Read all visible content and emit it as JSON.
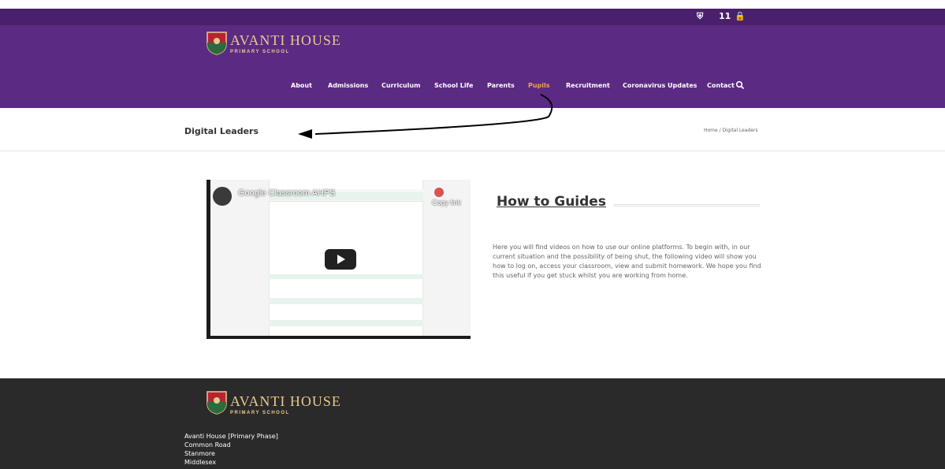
{
  "topbar": {
    "icon_shield": "shield-icon",
    "weather": "11",
    "icon_lock": "lock-icon"
  },
  "brand": {
    "title": "AVANTI HOUSE",
    "subtitle": "PRIMARY SCHOOL",
    "crest_colors": [
      "#b8232f",
      "#2d6a3e",
      "#e8c98f"
    ]
  },
  "nav": [
    {
      "label": "About"
    },
    {
      "label": "Admissions"
    },
    {
      "label": "Curriculum"
    },
    {
      "label": "School Life"
    },
    {
      "label": "Parents"
    },
    {
      "label": "Pupils",
      "active": true
    },
    {
      "label": "Recruitment"
    },
    {
      "label": "Coronavirus Updates"
    },
    {
      "label": "Contact"
    }
  ],
  "page": {
    "title": "Digital Leaders",
    "breadcrumb": "Home / Digital Leaders"
  },
  "video": {
    "title": "Google Classroom AHPS",
    "copy_link": "Copy link"
  },
  "guides": {
    "title": "How to Guides",
    "body": "Here you will find videos on how to use our online platforms. To begin with, in our current situation and the possibility of being shut, the following video will show you how to log on, access your classroom, view and submit homework. We hope you find this useful if you get stuck whilst you are working from home."
  },
  "footer": {
    "address": [
      "Avanti House [Primary Phase]",
      "Common Road",
      "Stanmore",
      "Middlesex"
    ]
  },
  "colors": {
    "topbar": "#4a1f6b",
    "header": "#5b2a82",
    "active_nav": "#f0a24a",
    "footer": "#2a2a2a",
    "brand": "#e8c98f"
  }
}
